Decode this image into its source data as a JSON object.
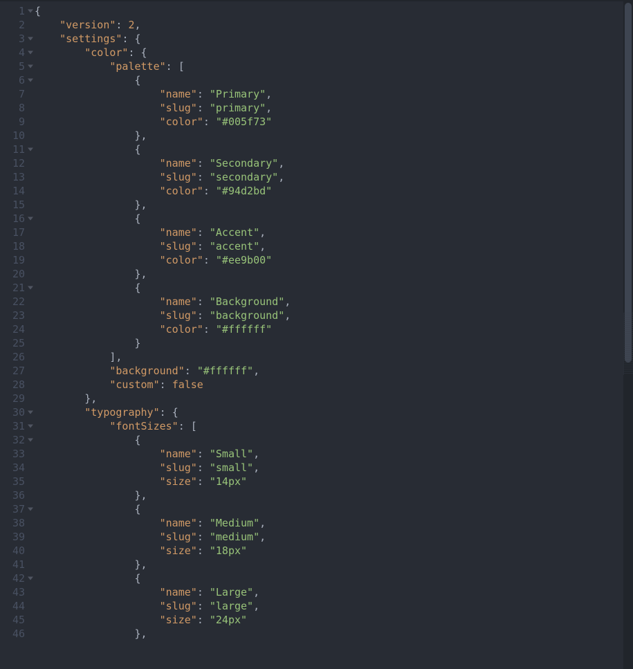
{
  "editor": {
    "lines": [
      {
        "n": 1,
        "fold": true,
        "indent": 0,
        "kind": "open-brace"
      },
      {
        "n": 2,
        "fold": false,
        "indent": 1,
        "kind": "kv-num",
        "key": "version",
        "value": "2",
        "trailingComma": true
      },
      {
        "n": 3,
        "fold": true,
        "indent": 1,
        "kind": "kv-open",
        "key": "settings",
        "brace": "{"
      },
      {
        "n": 4,
        "fold": true,
        "indent": 2,
        "kind": "kv-open",
        "key": "color",
        "brace": "{"
      },
      {
        "n": 5,
        "fold": true,
        "indent": 3,
        "kind": "kv-open",
        "key": "palette",
        "brace": "["
      },
      {
        "n": 6,
        "fold": true,
        "indent": 4,
        "kind": "open-brace"
      },
      {
        "n": 7,
        "fold": false,
        "indent": 5,
        "kind": "kv-str",
        "key": "name",
        "value": "Primary",
        "trailingComma": true
      },
      {
        "n": 8,
        "fold": false,
        "indent": 5,
        "kind": "kv-str",
        "key": "slug",
        "value": "primary",
        "trailingComma": true
      },
      {
        "n": 9,
        "fold": false,
        "indent": 5,
        "kind": "kv-str",
        "key": "color",
        "value": "#005f73",
        "trailingComma": false
      },
      {
        "n": 10,
        "fold": false,
        "indent": 4,
        "kind": "close",
        "brace": "}",
        "trailingComma": true
      },
      {
        "n": 11,
        "fold": true,
        "indent": 4,
        "kind": "open-brace"
      },
      {
        "n": 12,
        "fold": false,
        "indent": 5,
        "kind": "kv-str",
        "key": "name",
        "value": "Secondary",
        "trailingComma": true
      },
      {
        "n": 13,
        "fold": false,
        "indent": 5,
        "kind": "kv-str",
        "key": "slug",
        "value": "secondary",
        "trailingComma": true
      },
      {
        "n": 14,
        "fold": false,
        "indent": 5,
        "kind": "kv-str",
        "key": "color",
        "value": "#94d2bd",
        "trailingComma": false
      },
      {
        "n": 15,
        "fold": false,
        "indent": 4,
        "kind": "close",
        "brace": "}",
        "trailingComma": true
      },
      {
        "n": 16,
        "fold": true,
        "indent": 4,
        "kind": "open-brace"
      },
      {
        "n": 17,
        "fold": false,
        "indent": 5,
        "kind": "kv-str",
        "key": "name",
        "value": "Accent",
        "trailingComma": true
      },
      {
        "n": 18,
        "fold": false,
        "indent": 5,
        "kind": "kv-str",
        "key": "slug",
        "value": "accent",
        "trailingComma": true
      },
      {
        "n": 19,
        "fold": false,
        "indent": 5,
        "kind": "kv-str",
        "key": "color",
        "value": "#ee9b00",
        "trailingComma": false
      },
      {
        "n": 20,
        "fold": false,
        "indent": 4,
        "kind": "close",
        "brace": "}",
        "trailingComma": true
      },
      {
        "n": 21,
        "fold": true,
        "indent": 4,
        "kind": "open-brace"
      },
      {
        "n": 22,
        "fold": false,
        "indent": 5,
        "kind": "kv-str",
        "key": "name",
        "value": "Background",
        "trailingComma": true
      },
      {
        "n": 23,
        "fold": false,
        "indent": 5,
        "kind": "kv-str",
        "key": "slug",
        "value": "background",
        "trailingComma": true
      },
      {
        "n": 24,
        "fold": false,
        "indent": 5,
        "kind": "kv-str",
        "key": "color",
        "value": "#ffffff",
        "trailingComma": false
      },
      {
        "n": 25,
        "fold": false,
        "indent": 4,
        "kind": "close",
        "brace": "}",
        "trailingComma": false
      },
      {
        "n": 26,
        "fold": false,
        "indent": 3,
        "kind": "close",
        "brace": "]",
        "trailingComma": true
      },
      {
        "n": 27,
        "fold": false,
        "indent": 3,
        "kind": "kv-str",
        "key": "background",
        "value": "#ffffff",
        "trailingComma": true
      },
      {
        "n": 28,
        "fold": false,
        "indent": 3,
        "kind": "kv-bool",
        "key": "custom",
        "value": "false",
        "trailingComma": false
      },
      {
        "n": 29,
        "fold": false,
        "indent": 2,
        "kind": "close",
        "brace": "}",
        "trailingComma": true
      },
      {
        "n": 30,
        "fold": true,
        "indent": 2,
        "kind": "kv-open",
        "key": "typography",
        "brace": "{"
      },
      {
        "n": 31,
        "fold": true,
        "indent": 3,
        "kind": "kv-open",
        "key": "fontSizes",
        "brace": "["
      },
      {
        "n": 32,
        "fold": true,
        "indent": 4,
        "kind": "open-brace"
      },
      {
        "n": 33,
        "fold": false,
        "indent": 5,
        "kind": "kv-str",
        "key": "name",
        "value": "Small",
        "trailingComma": true
      },
      {
        "n": 34,
        "fold": false,
        "indent": 5,
        "kind": "kv-str",
        "key": "slug",
        "value": "small",
        "trailingComma": true
      },
      {
        "n": 35,
        "fold": false,
        "indent": 5,
        "kind": "kv-str",
        "key": "size",
        "value": "14px",
        "trailingComma": false
      },
      {
        "n": 36,
        "fold": false,
        "indent": 4,
        "kind": "close",
        "brace": "}",
        "trailingComma": true
      },
      {
        "n": 37,
        "fold": true,
        "indent": 4,
        "kind": "open-brace"
      },
      {
        "n": 38,
        "fold": false,
        "indent": 5,
        "kind": "kv-str",
        "key": "name",
        "value": "Medium",
        "trailingComma": true
      },
      {
        "n": 39,
        "fold": false,
        "indent": 5,
        "kind": "kv-str",
        "key": "slug",
        "value": "medium",
        "trailingComma": true
      },
      {
        "n": 40,
        "fold": false,
        "indent": 5,
        "kind": "kv-str",
        "key": "size",
        "value": "18px",
        "trailingComma": false
      },
      {
        "n": 41,
        "fold": false,
        "indent": 4,
        "kind": "close",
        "brace": "}",
        "trailingComma": true
      },
      {
        "n": 42,
        "fold": true,
        "indent": 4,
        "kind": "open-brace"
      },
      {
        "n": 43,
        "fold": false,
        "indent": 5,
        "kind": "kv-str",
        "key": "name",
        "value": "Large",
        "trailingComma": true
      },
      {
        "n": 44,
        "fold": false,
        "indent": 5,
        "kind": "kv-str",
        "key": "slug",
        "value": "large",
        "trailingComma": true
      },
      {
        "n": 45,
        "fold": false,
        "indent": 5,
        "kind": "kv-str",
        "key": "size",
        "value": "24px",
        "trailingComma": false
      },
      {
        "n": 46,
        "fold": false,
        "indent": 4,
        "kind": "close",
        "brace": "}",
        "trailingComma": true
      }
    ],
    "indentUnit": "    "
  }
}
